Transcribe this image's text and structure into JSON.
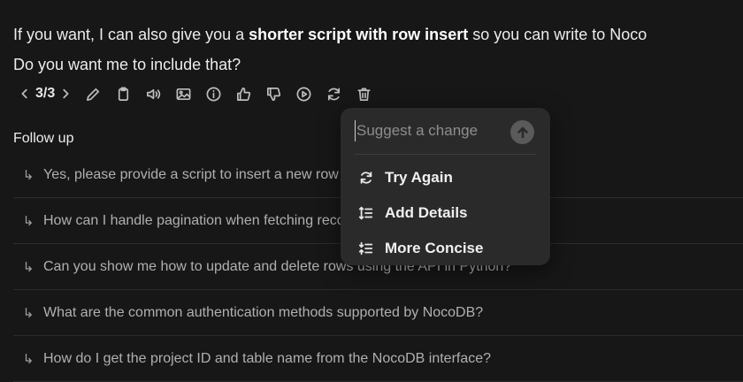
{
  "message": {
    "line1_before": "If you want, I can also give you a ",
    "line1_bold": "shorter script with row insert",
    "line1_after": " so you can write to Noco",
    "line2": "Do you want me to include that?"
  },
  "toolbar": {
    "pager": "3/3",
    "icons": [
      "chevron-left-icon",
      "chevron-right-icon",
      "pencil-icon",
      "clipboard-icon",
      "speaker-icon",
      "image-icon",
      "info-icon",
      "thumbs-up-icon",
      "thumbs-down-icon",
      "play-icon",
      "refresh-icon",
      "trash-icon"
    ]
  },
  "followup": {
    "title": "Follow up",
    "arrow": "↳",
    "items": [
      "Yes, please provide a script to insert a new row into NocoDB.",
      "How can I handle pagination when fetching records from NocoDB?",
      "Can you show me how to update and delete rows using the API in Python?",
      "What are the common authentication methods supported by NocoDB?",
      "How do I get the project ID and table name from the NocoDB interface?"
    ]
  },
  "popup": {
    "placeholder": "Suggest a change",
    "items": [
      {
        "label": "Try Again",
        "icon": "refresh-icon"
      },
      {
        "label": "Add Details",
        "icon": "list-expand-icon"
      },
      {
        "label": "More Concise",
        "icon": "list-collapse-icon"
      }
    ]
  }
}
